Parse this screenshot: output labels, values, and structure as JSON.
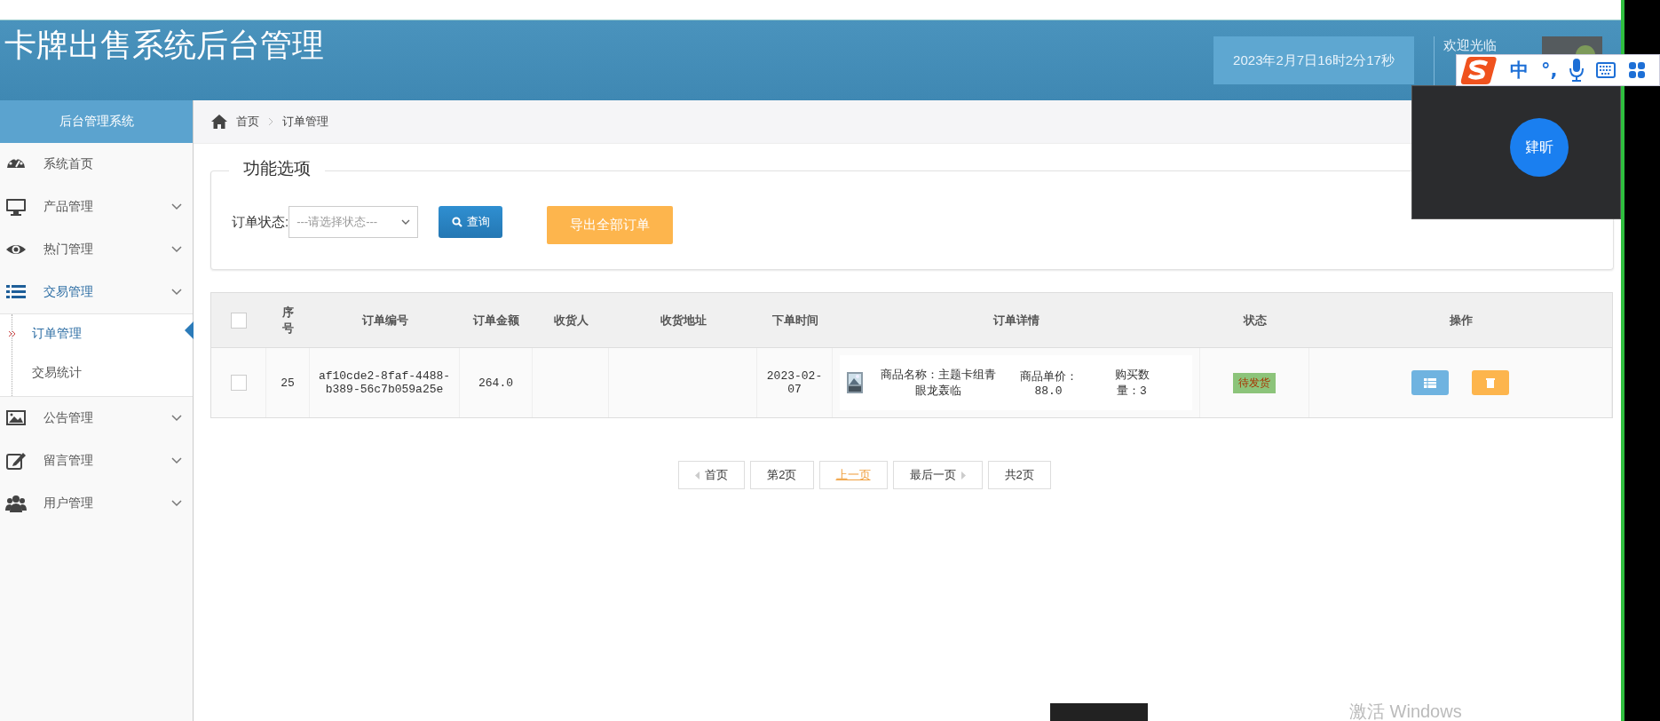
{
  "header": {
    "title": "卡牌出售系统后台管理",
    "datetime": "2023年2月7日16时2分17秒",
    "welcome": "欢迎光临"
  },
  "sidebar": {
    "title": "后台管理系统",
    "items": [
      {
        "label": "系统首页",
        "kind": "link",
        "selected": false
      },
      {
        "label": "产品管理",
        "kind": "menu",
        "selected": false
      },
      {
        "label": "热门管理",
        "kind": "menu",
        "selected": false
      },
      {
        "label": "交易管理",
        "kind": "menu",
        "selected": true,
        "children": [
          {
            "label": "订单管理",
            "selected": true
          },
          {
            "label": "交易统计",
            "selected": false
          }
        ]
      },
      {
        "label": "公告管理",
        "kind": "menu",
        "selected": false
      },
      {
        "label": "留言管理",
        "kind": "menu",
        "selected": false
      },
      {
        "label": "用户管理",
        "kind": "menu",
        "selected": false
      }
    ]
  },
  "breadcrumb": [
    "首页",
    "订单管理"
  ],
  "filter": {
    "legend": "功能选项",
    "label": "订单状态:",
    "select_placeholder": "---请选择状态---",
    "query_button": "查询",
    "export_button": "导出全部订单"
  },
  "table": {
    "select_all": false,
    "columns": [
      "序号",
      "订单编号",
      "订单金额",
      "收货人",
      "收货地址",
      "下单时间",
      "订单详情",
      "状态",
      "操作"
    ],
    "rows": [
      {
        "checked": false,
        "index": "25",
        "order_no": "af10cde2-8faf-4488-b389-56c7b059a25e",
        "amount": "264.0",
        "receiver": "",
        "address": "",
        "time": "2023-02-07",
        "detail": {
          "name": "商品名称：主题卡组青眼龙轰临",
          "price": "商品单价：88.0",
          "quantity": "购买数量：3"
        },
        "status": "待发货"
      }
    ]
  },
  "pagination": [
    {
      "label": "首页",
      "active": false
    },
    {
      "label": "第2页",
      "active": false
    },
    {
      "label": "上一页",
      "active": true
    },
    {
      "label": "最后一页",
      "active": false
    },
    {
      "label": "共2页",
      "active": false
    }
  ],
  "overlays": {
    "ime": {
      "mode": "中",
      "punct": "°,"
    },
    "video": {
      "name": "肄昕"
    },
    "os_notice": "激活 Windows"
  }
}
